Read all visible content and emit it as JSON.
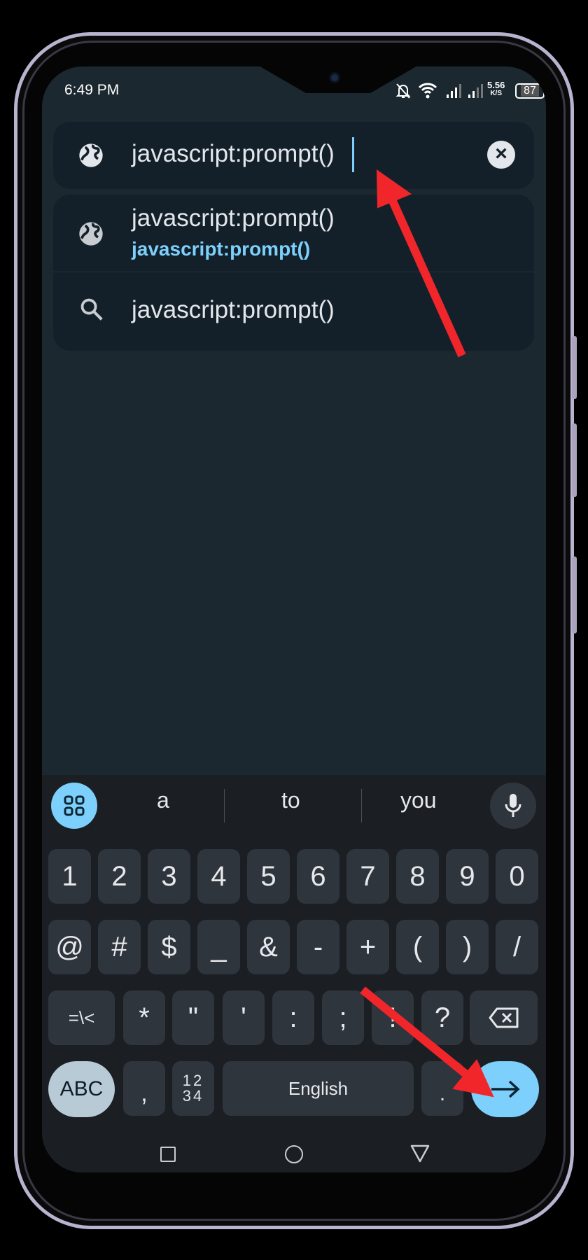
{
  "status_bar": {
    "time": "6:49 PM",
    "speed_value": "5.56",
    "speed_unit": "K/S",
    "battery": "87",
    "icons": [
      "bell-off-icon",
      "wifi-icon",
      "signal-icon",
      "signal-icon",
      "battery-icon"
    ]
  },
  "address_bar": {
    "value": "javascript:prompt()",
    "icon": "globe-icon",
    "clear_icon": "close-circle-icon"
  },
  "suggestions": [
    {
      "icon": "globe-icon",
      "title": "javascript:prompt()",
      "url": "javascript:prompt()"
    },
    {
      "icon": "search-icon",
      "title": "javascript:prompt()"
    }
  ],
  "keyboard": {
    "candidates": [
      "a",
      "to",
      "you"
    ],
    "row1": [
      "1",
      "2",
      "3",
      "4",
      "5",
      "6",
      "7",
      "8",
      "9",
      "0"
    ],
    "row2": [
      "@",
      "#",
      "$",
      "_",
      "&",
      "-",
      "+",
      "(",
      ")",
      "/"
    ],
    "row3": [
      "=\\<",
      "*",
      "\"",
      "'",
      ":",
      ";",
      "!",
      "?"
    ],
    "row4": {
      "abc": "ABC",
      "comma": ",",
      "numpad_top": "12",
      "numpad_bottom": "34",
      "space": "English",
      "period": "."
    },
    "accent": "#7cd0fb"
  },
  "annotation_color": "#f0262b"
}
